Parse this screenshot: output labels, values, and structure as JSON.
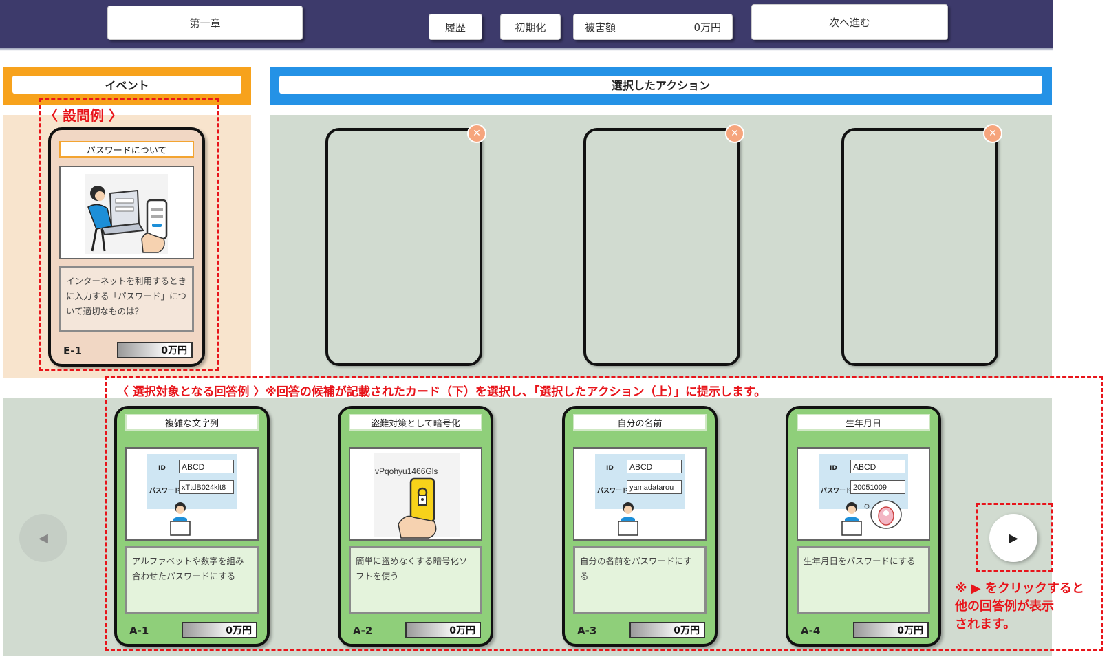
{
  "header": {
    "chapter_label": "第一章",
    "history_label": "履歴",
    "reset_label": "初期化",
    "damage_label": "被害額",
    "damage_value": "0万円",
    "next_label": "次へ進む"
  },
  "sections": {
    "event_title": "イベント",
    "action_title": "選択したアクション"
  },
  "event_card": {
    "title": "パスワードについて",
    "description": "インターネットを利用するときに入力する「パスワード」について適切なものは？",
    "id": "E-1",
    "value": "0万円"
  },
  "action_slots": {
    "remove_glyph": "✕"
  },
  "candidates": [
    {
      "title": "複雑な文字列",
      "description": "アルファベットや数字を組み合わせたパスワードにする",
      "id": "A-1",
      "value": "0万円",
      "login_id": "ABCD",
      "login_password": "xTtdB024klt8"
    },
    {
      "title": "盗難対策として暗号化",
      "description": "簡単に盗めなくする暗号化ソフトを使う",
      "id": "A-2",
      "value": "0万円",
      "screen_text": "vPqohyu1466Gls"
    },
    {
      "title": "自分の名前",
      "description": "自分の名前をパスワードにする",
      "id": "A-3",
      "value": "0万円",
      "login_id": "ABCD",
      "login_password": "yamadatarou"
    },
    {
      "title": "生年月日",
      "description": "生年月日をパスワードにする",
      "id": "A-4",
      "value": "0万円",
      "login_id": "ABCD",
      "login_password": "20051009"
    }
  ],
  "login_labels": {
    "id_label": "ID",
    "password_label": "パスワード"
  },
  "navigation": {
    "prev_glyph": "◀",
    "next_glyph": "▶"
  },
  "annotations": {
    "question_example": "〈 設問例 〉",
    "answer_examples": "〈 選択対象となる回答例 〉※回答の候補が記載されたカード（下）を選択し、「選択したアクション（上）」に提示します。",
    "next_note_line1": "※ ▶ をクリックすると",
    "next_note_line2": "他の回答例が表示",
    "next_note_line3": "されます。"
  },
  "colors": {
    "topbar": "#3d3a6b",
    "event_accent": "#f7a21c",
    "action_accent": "#2492e6",
    "green_card": "#8fcf7a",
    "annotation_red": "#e8141a"
  }
}
